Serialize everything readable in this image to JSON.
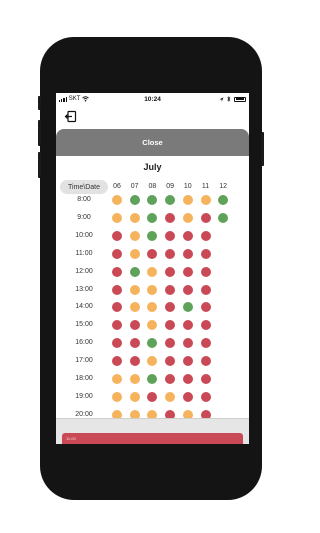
{
  "status_bar": {
    "carrier": "SKT",
    "time": "10:24"
  },
  "sheet": {
    "close_label": "Close",
    "month": "July"
  },
  "grid": {
    "corner_label": "Time\\Date",
    "dates": [
      "06",
      "07",
      "08",
      "09",
      "10",
      "11",
      "12"
    ],
    "times": [
      "8:00",
      "9:00",
      "10:00",
      "11:00",
      "12:00",
      "13:00",
      "14:00",
      "15:00",
      "16:00",
      "17:00",
      "18:00",
      "19:00",
      "20:00"
    ],
    "status_colors": {
      "O": "#f6b35e",
      "G": "#5fa35a",
      "R": "#c94a56"
    },
    "rows": [
      [
        "O",
        "G",
        "G",
        "G",
        "O",
        "O",
        "G"
      ],
      [
        "O",
        "O",
        "G",
        "R",
        "O",
        "R",
        "G"
      ],
      [
        "R",
        "O",
        "G",
        "R",
        "R",
        "R",
        ""
      ],
      [
        "R",
        "O",
        "R",
        "R",
        "R",
        "R",
        ""
      ],
      [
        "R",
        "G",
        "O",
        "R",
        "R",
        "R",
        ""
      ],
      [
        "R",
        "O",
        "O",
        "R",
        "R",
        "R",
        ""
      ],
      [
        "R",
        "O",
        "O",
        "R",
        "G",
        "R",
        ""
      ],
      [
        "R",
        "R",
        "O",
        "R",
        "R",
        "R",
        ""
      ],
      [
        "R",
        "R",
        "G",
        "R",
        "R",
        "R",
        ""
      ],
      [
        "R",
        "R",
        "O",
        "R",
        "R",
        "R",
        ""
      ],
      [
        "O",
        "O",
        "G",
        "R",
        "R",
        "R",
        ""
      ],
      [
        "O",
        "O",
        "R",
        "O",
        "R",
        "R",
        ""
      ],
      [
        "O",
        "O",
        "O",
        "R",
        "O",
        "R",
        ""
      ]
    ]
  },
  "bottom_bar": {
    "text": "11:00"
  }
}
